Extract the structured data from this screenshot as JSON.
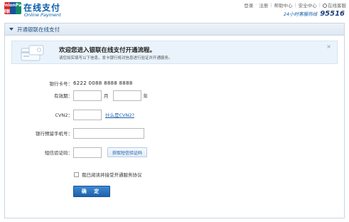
{
  "header": {
    "logo_mark": "UnionPay 银联",
    "logo_cn": "在线支付",
    "logo_en": "Online Payment",
    "nav": [
      "登录",
      "注册",
      "帮助中心",
      "安全中心",
      "在线客服"
    ],
    "hotline_label": "24小时客服热线",
    "hotline_number": "95516"
  },
  "panel": {
    "title": "开通银联在线支付"
  },
  "notice": {
    "title": "欢迎您进入银联在线支付开通流程。",
    "subtitle": "请您如实填写以下信息，发卡银行将对信息进行验证并开通服务。",
    "close": "×"
  },
  "form": {
    "card_label": "银行卡号：",
    "card_value": "6222 0088 8888 8888",
    "expiry_label": "有效期：",
    "expiry_month_unit": "月",
    "expiry_year_unit": "年",
    "month_value": "",
    "year_value": "",
    "cvn2_label": "CVN2：",
    "cvn2_value": "",
    "cvn2_help": "什么是CVN2?",
    "phone_label": "银行预留手机号：",
    "phone_value": "",
    "sms_label": "短信验证码：",
    "sms_value": "",
    "sms_button": "获取短信验证码",
    "agree_text": "我已阅读并接受开通服务协议",
    "submit": "确 定"
  }
}
